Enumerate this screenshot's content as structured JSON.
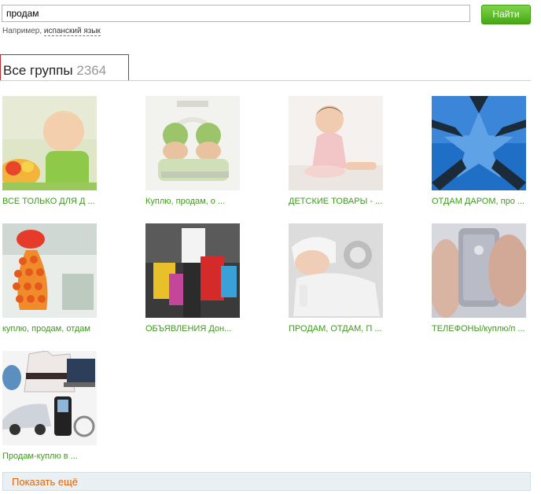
{
  "search": {
    "value": "продам",
    "button_label": "Найти"
  },
  "hint": {
    "prefix": "Например,",
    "example_link": "испанский язык"
  },
  "header": {
    "title": "Все группы",
    "count": "2364"
  },
  "groups": [
    {
      "label": "ВСЕ ТОЛЬКО ДЛЯ Д ...",
      "image": "child-eating-photo"
    },
    {
      "label": "Куплю, продам, о ...",
      "image": "twin-babies-photo"
    },
    {
      "label": "ДЕТСКИЕ ТОВАРЫ - ...",
      "image": "baby-girl-photo"
    },
    {
      "label": "ОТДАМ ДАРОМ, про ...",
      "image": "hands-star-photo"
    },
    {
      "label": "куплю, продам, отдам",
      "image": "lollipop-tree-photo"
    },
    {
      "label": "ОБЪЯВЛЕНИЯ Дон...",
      "image": "shopping-bags-photo"
    },
    {
      "label": "ПРОДАМ, ОТДАМ, П ...",
      "image": "sleeping-baby-photo"
    },
    {
      "label": "ТЕЛЕФОНЫ/куплю/п ...",
      "image": "smartphone-photo"
    },
    {
      "label": "Продам-куплю в ...",
      "image": "products-collage-photo"
    }
  ],
  "show_more": {
    "label": "Показать ещё"
  },
  "colors": {
    "accent_green": "#3d9b1c",
    "button_green": "#46a816",
    "highlight_red": "#c9252b",
    "more_orange": "#e0640a"
  }
}
